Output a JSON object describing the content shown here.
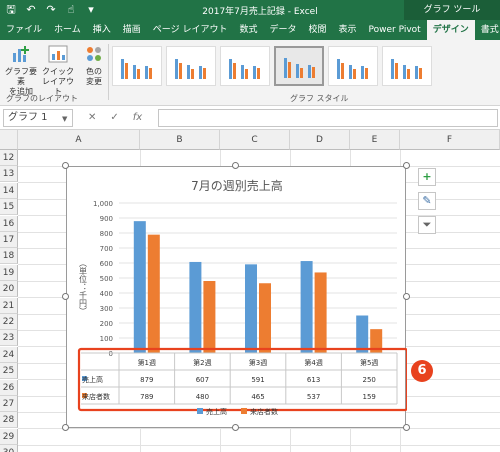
{
  "titlebar": {
    "title": "2017年7月売上記録 - Excel",
    "context_title": "グラフ ツール",
    "qat": [
      "save-icon",
      "undo-icon",
      "redo-icon",
      "touch-mode-icon",
      "customize-icon"
    ]
  },
  "tabs": [
    "ファイル",
    "ホーム",
    "挿入",
    "描画",
    "ページ レイアウト",
    "数式",
    "データ",
    "校閲",
    "表示",
    "Power Pivot",
    "デザイン",
    "書式"
  ],
  "active_tab": "デザイン",
  "ribbon": {
    "add_element": "グラフ要素\nを追加",
    "quick_layout": "クイック\nレイアウト",
    "change_color": "色の\n変更",
    "group_layout": "グラフのレイアウト",
    "group_styles": "グラフ スタイル"
  },
  "formula_bar": {
    "name_box": "グラフ 1",
    "cancel": "✕",
    "enter": "✓",
    "fx": "fx",
    "value": ""
  },
  "columns": [
    "A",
    "B",
    "C",
    "D",
    "E",
    "F"
  ],
  "rows": [
    "12",
    "13",
    "14",
    "15",
    "16",
    "17",
    "18",
    "19",
    "20",
    "21",
    "22",
    "23",
    "24",
    "25",
    "26",
    "27",
    "28",
    "29",
    "30"
  ],
  "chart_data": {
    "type": "bar",
    "title": "7月の週別売上高",
    "ylabel": "（単位：千円）",
    "categories": [
      "第1週",
      "第2週",
      "第3週",
      "第4週",
      "第5週"
    ],
    "series": [
      {
        "name": "売上高",
        "values": [
          879,
          607,
          591,
          613,
          250
        ],
        "color": "#5b9bd5"
      },
      {
        "name": "来店者数",
        "values": [
          789,
          480,
          465,
          537,
          159
        ],
        "color": "#ed7d31"
      }
    ],
    "yticks": [
      "1,000",
      "900",
      "800",
      "700",
      "600",
      "500",
      "400",
      "300",
      "200",
      "100",
      "0"
    ],
    "ylim": [
      0,
      1000
    ],
    "data_table": true,
    "legend": "bottom"
  },
  "callout": "6",
  "colors": {
    "excel_green": "#217346",
    "highlight_red": "#e8421e"
  }
}
